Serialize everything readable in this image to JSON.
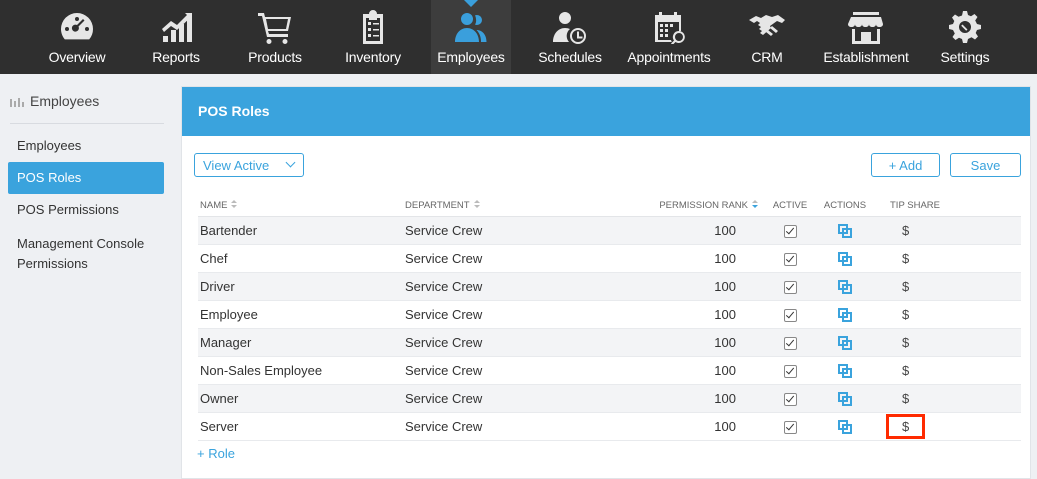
{
  "nav": {
    "items": [
      {
        "label": "Overview",
        "icon": "speedometer-icon"
      },
      {
        "label": "Reports",
        "icon": "chart-icon"
      },
      {
        "label": "Products",
        "icon": "cart-icon"
      },
      {
        "label": "Inventory",
        "icon": "clipboard-icon"
      },
      {
        "label": "Employees",
        "icon": "people-icon",
        "active": true
      },
      {
        "label": "Schedules",
        "icon": "person-clock-icon"
      },
      {
        "label": "Appointments",
        "icon": "calendar-icon"
      },
      {
        "label": "CRM",
        "icon": "handshake-icon"
      },
      {
        "label": "Establishment",
        "icon": "store-icon"
      },
      {
        "label": "Settings",
        "icon": "gear-icon"
      }
    ]
  },
  "sidebar": {
    "title": "Employees",
    "items": [
      {
        "label": "Employees"
      },
      {
        "label": "POS Roles",
        "active": true
      },
      {
        "label": "POS Permissions"
      },
      {
        "label": "Management Console Permissions"
      }
    ]
  },
  "panel": {
    "title": "POS Roles",
    "view_filter": "View Active",
    "add_label": "+ Add",
    "save_label": "Save",
    "add_role_label": "+ Role"
  },
  "table": {
    "headers": {
      "name": "NAME",
      "department": "DEPARTMENT",
      "rank": "PERMISSION RANK",
      "active": "ACTIVE",
      "actions": "ACTIONS",
      "tip": "TIP SHARE"
    },
    "rows": [
      {
        "name": "Bartender",
        "department": "Service Crew",
        "rank": "100",
        "tip": "$"
      },
      {
        "name": "Chef",
        "department": "Service Crew",
        "rank": "100",
        "tip": "$"
      },
      {
        "name": "Driver",
        "department": "Service Crew",
        "rank": "100",
        "tip": "$"
      },
      {
        "name": "Employee",
        "department": "Service Crew",
        "rank": "100",
        "tip": "$"
      },
      {
        "name": "Manager",
        "department": "Service Crew",
        "rank": "100",
        "tip": "$"
      },
      {
        "name": "Non-Sales Employee",
        "department": "Service Crew",
        "rank": "100",
        "tip": "$"
      },
      {
        "name": "Owner",
        "department": "Service Crew",
        "rank": "100",
        "tip": "$"
      },
      {
        "name": "Server",
        "department": "Service Crew",
        "rank": "100",
        "tip": "$",
        "highlighted": true
      }
    ]
  },
  "colors": {
    "accent": "#3aa3dd",
    "nav_bg": "#2f2f2f",
    "highlight": "#ff2a00"
  }
}
